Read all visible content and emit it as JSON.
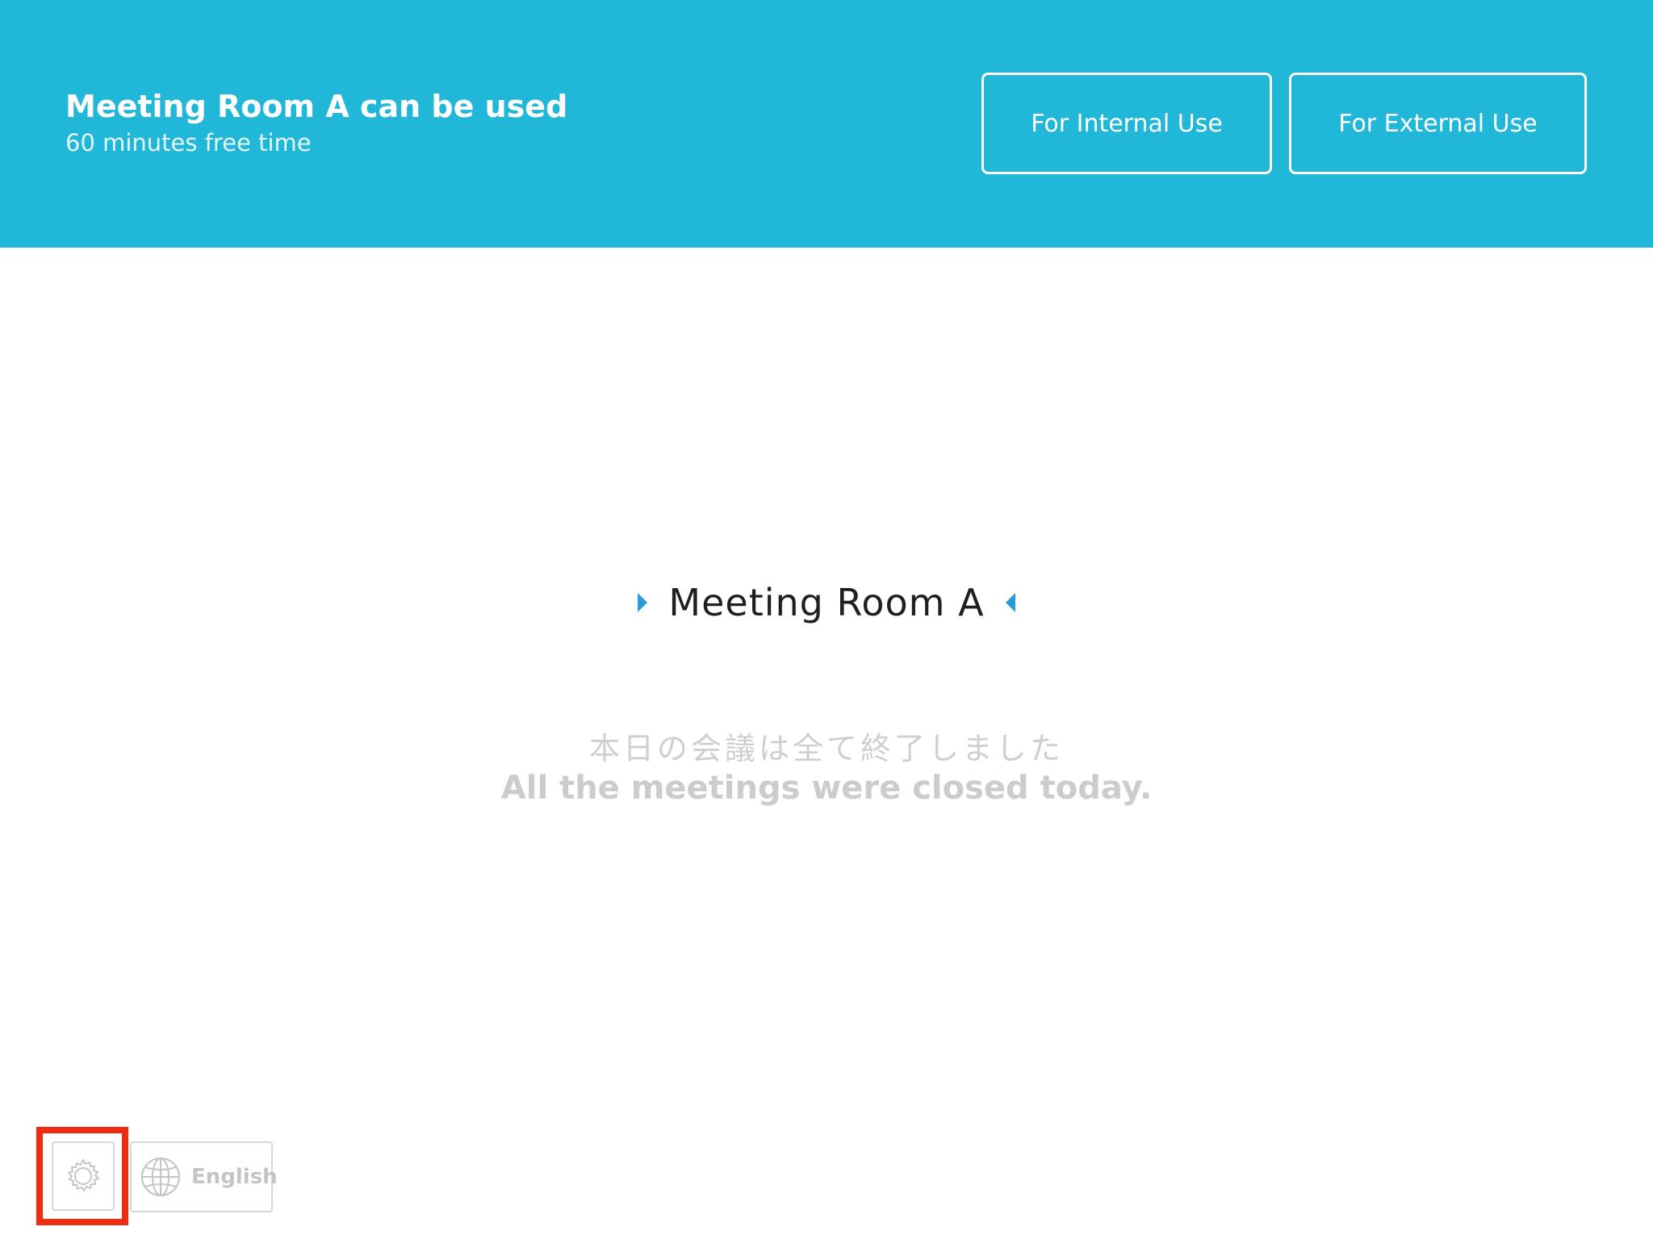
{
  "header": {
    "title": "Meeting Room A can be used",
    "subtitle": "60 minutes free time",
    "buttons": {
      "internal_label": "For Internal Use",
      "external_label": "For External Use"
    },
    "background_color": "#20b7d8"
  },
  "room": {
    "name": "Meeting Room A",
    "arrow_color": "#2a9bd6",
    "left_icon": "caret-right-icon",
    "right_icon": "caret-left-icon"
  },
  "status": {
    "message_jp": "本日の会議は全て終了しました",
    "message_en": "All the meetings were closed today."
  },
  "footer": {
    "settings_icon": "gear-icon",
    "language_icon": "globe-icon",
    "language_label": "English",
    "highlight_color": "#f02c10"
  }
}
